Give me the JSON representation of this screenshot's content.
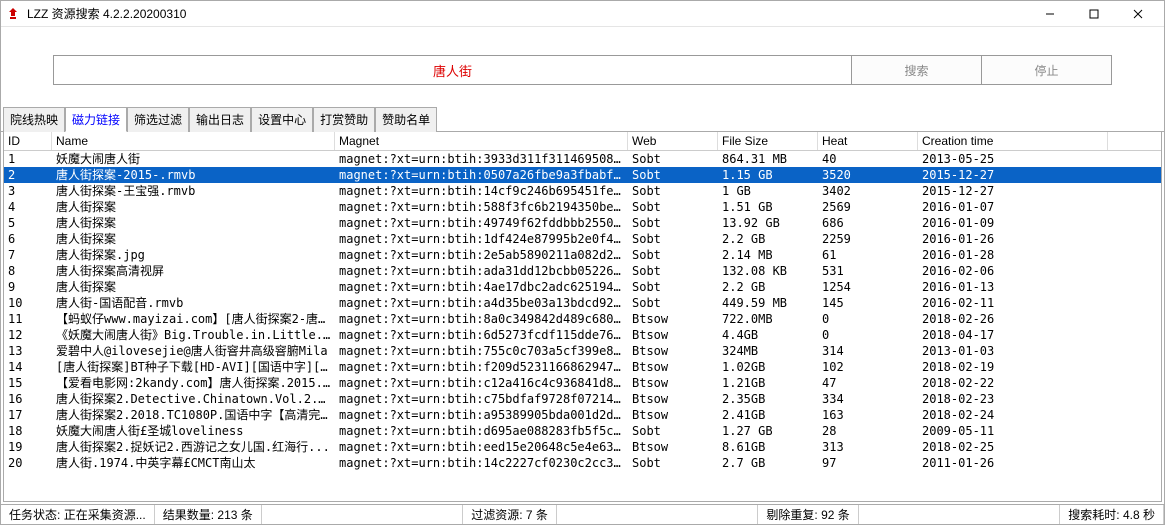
{
  "window": {
    "title": "LZZ 资源搜索 4.2.2.20200310"
  },
  "search": {
    "value": "唐人街",
    "searchBtn": "搜索",
    "stopBtn": "停止"
  },
  "tabs": [
    "院线热映",
    "磁力链接",
    "筛选过滤",
    "输出日志",
    "设置中心",
    "打赏赞助",
    "赞助名单"
  ],
  "activeTab": 1,
  "columns": {
    "id": "ID",
    "name": "Name",
    "magnet": "Magnet",
    "web": "Web",
    "fs": "File Size",
    "heat": "Heat",
    "ct": "Creation time"
  },
  "selectedRow": 1,
  "rows": [
    {
      "id": "1",
      "name": "妖魔大闹唐人街",
      "magnet": "magnet:?xt=urn:btih:3933d311f31146950876...",
      "web": "Sobt",
      "fs": "864.31 MB",
      "heat": "40",
      "ct": "2013-05-25"
    },
    {
      "id": "2",
      "name": "唐人街探案-2015-.rmvb",
      "magnet": "magnet:?xt=urn:btih:0507a26fbe9a3fbabfc5a...",
      "web": "Sobt",
      "fs": "1.15 GB",
      "heat": "3520",
      "ct": "2015-12-27"
    },
    {
      "id": "3",
      "name": "唐人街探案-王宝强.rmvb",
      "magnet": "magnet:?xt=urn:btih:14cf9c246b695451fef7c...",
      "web": "Sobt",
      "fs": "1 GB",
      "heat": "3402",
      "ct": "2015-12-27"
    },
    {
      "id": "4",
      "name": "唐人街探案",
      "magnet": "magnet:?xt=urn:btih:588f3fc6b2194350be923...",
      "web": "Sobt",
      "fs": "1.51 GB",
      "heat": "2569",
      "ct": "2016-01-07"
    },
    {
      "id": "5",
      "name": "唐人街探案",
      "magnet": "magnet:?xt=urn:btih:49749f62fddbbb25500c8...",
      "web": "Sobt",
      "fs": "13.92 GB",
      "heat": "686",
      "ct": "2016-01-09"
    },
    {
      "id": "6",
      "name": "唐人街探案",
      "magnet": "magnet:?xt=urn:btih:1df424e87995b2e0f4548...",
      "web": "Sobt",
      "fs": "2.2 GB",
      "heat": "2259",
      "ct": "2016-01-26"
    },
    {
      "id": "7",
      "name": "唐人街探案.jpg",
      "magnet": "magnet:?xt=urn:btih:2e5ab5890211a082d2b58...",
      "web": "Sobt",
      "fs": "2.14 MB",
      "heat": "61",
      "ct": "2016-01-28"
    },
    {
      "id": "8",
      "name": "唐人街探案高清视屏",
      "magnet": "magnet:?xt=urn:btih:ada31dd12bcbb05226a65...",
      "web": "Sobt",
      "fs": "132.08 KB",
      "heat": "531",
      "ct": "2016-02-06"
    },
    {
      "id": "9",
      "name": "唐人街探案",
      "magnet": "magnet:?xt=urn:btih:4ae17dbc2adc625194347...",
      "web": "Sobt",
      "fs": "2.2 GB",
      "heat": "1254",
      "ct": "2016-01-13"
    },
    {
      "id": "10",
      "name": "唐人街-国语配音.rmvb",
      "magnet": "magnet:?xt=urn:btih:a4d35be03a13bdcd92965...",
      "web": "Sobt",
      "fs": "449.59 MB",
      "heat": "145",
      "ct": "2016-02-11"
    },
    {
      "id": "11",
      "name": "【蚂蚁仔www.mayizai.com】[唐人街探案2-唐...",
      "magnet": "magnet:?xt=urn:btih:8a0c349842d489c680ccc...",
      "web": "Btsow",
      "fs": "722.0MB",
      "heat": "0",
      "ct": "2018-02-26"
    },
    {
      "id": "12",
      "name": "《妖魔大闹唐人街》Big.Trouble.in.Little.C...",
      "magnet": "magnet:?xt=urn:btih:6d5273fcdf115dde76d2f...",
      "web": "Btsow",
      "fs": "4.4GB",
      "heat": "0",
      "ct": "2018-04-17"
    },
    {
      "id": "13",
      "name": "爱碧中人@ilovesejie@唐人街窨井高级窨腑Mila",
      "magnet": "magnet:?xt=urn:btih:755c0c703a5cf399e8241...",
      "web": "Btsow",
      "fs": "324MB",
      "heat": "314",
      "ct": "2013-01-03"
    },
    {
      "id": "14",
      "name": "[唐人街探案]BT种子下载[HD-AVI][国语中字][...",
      "magnet": "magnet:?xt=urn:btih:f209d52311668629479...",
      "web": "Btsow",
      "fs": "1.02GB",
      "heat": "102",
      "ct": "2018-02-19"
    },
    {
      "id": "15",
      "name": "【爱看电影网:2kandy.com】唐人街探案.2015...",
      "magnet": "magnet:?xt=urn:btih:c12a416c4c936841d8aa...",
      "web": "Btsow",
      "fs": "1.21GB",
      "heat": "47",
      "ct": "2018-02-22"
    },
    {
      "id": "16",
      "name": "唐人街探案2.Detective.Chinatown.Vol.2.201...",
      "magnet": "magnet:?xt=urn:btih:c75bdfaf9728f07214dc8...",
      "web": "Btsow",
      "fs": "2.35GB",
      "heat": "334",
      "ct": "2018-02-23"
    },
    {
      "id": "17",
      "name": "唐人街探案2.2018.TC1080P.国语中字【高清完...",
      "magnet": "magnet:?xt=urn:btih:a95389905bda001d2dc68...",
      "web": "Btsow",
      "fs": "2.41GB",
      "heat": "163",
      "ct": "2018-02-24"
    },
    {
      "id": "18",
      "name": "妖魔大闹唐人街£圣城loveliness",
      "magnet": "magnet:?xt=urn:btih:d695ae088283fb5f5c595...",
      "web": "Sobt",
      "fs": "1.27 GB",
      "heat": "28",
      "ct": "2009-05-11"
    },
    {
      "id": "19",
      "name": "唐人街探案2.捉妖记2.西游记之女儿国.红海行...",
      "magnet": "magnet:?xt=urn:btih:eed15e20648c5e4e6353...",
      "web": "Btsow",
      "fs": "8.61GB",
      "heat": "313",
      "ct": "2018-02-25"
    },
    {
      "id": "20",
      "name": "唐人街.1974.中英字幕£CMCT南山太",
      "magnet": "magnet:?xt=urn:btih:14c2227cf0230c2cc3c4e6...",
      "web": "Sobt",
      "fs": "2.7 GB",
      "heat": "97",
      "ct": "2011-01-26"
    }
  ],
  "status": {
    "task": {
      "label": "任务状态:",
      "value": "正在采集资源..."
    },
    "results": {
      "label": "结果数量:",
      "value": "213 条"
    },
    "filtered": {
      "label": "过滤资源:",
      "value": "7 条"
    },
    "dup": {
      "label": "剔除重复:",
      "value": "92 条"
    },
    "time": {
      "label": "搜索耗时:",
      "value": "4.8 秒"
    }
  }
}
